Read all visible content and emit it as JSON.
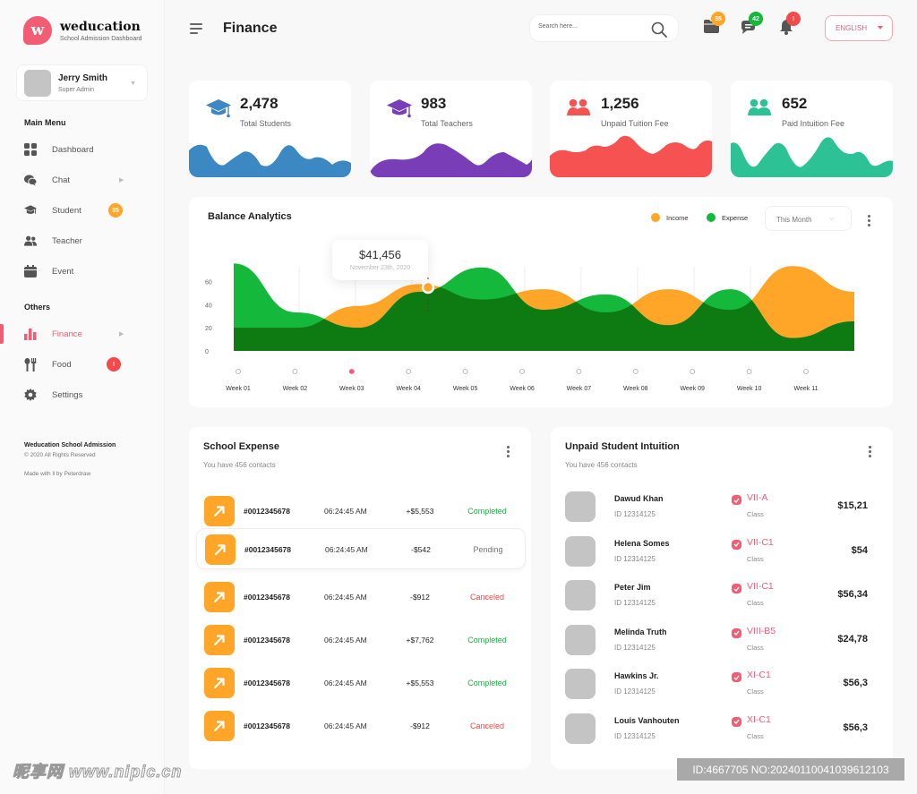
{
  "brand": {
    "logo_letter": "w",
    "name": "weducation",
    "subtitle": "School Admission Dashboard",
    "accent": "#f35d74"
  },
  "user": {
    "name": "Jerry Smith",
    "role": "Super Admin"
  },
  "sidebar": {
    "main_menu_title": "Main Menu",
    "main_items": [
      {
        "label": "Dashboard",
        "icon": "dashboard-grid-icon"
      },
      {
        "label": "Chat",
        "icon": "chat-icon",
        "has_chevron": true
      },
      {
        "label": "Student",
        "icon": "graduation-cap-icon",
        "badge": "35"
      },
      {
        "label": "Teacher",
        "icon": "users-icon"
      },
      {
        "label": "Event",
        "icon": "calendar-icon"
      }
    ],
    "others_title": "Others",
    "other_items": [
      {
        "label": "Finance",
        "icon": "bar-chart-icon",
        "active": true,
        "has_chevron": true
      },
      {
        "label": "Food",
        "icon": "fork-spoon-icon",
        "badge": "!"
      },
      {
        "label": "Settings",
        "icon": "gear-icon"
      }
    ],
    "footer": {
      "title": "Weducation School Admission",
      "copyright": "© 2020 All Rights Reserved",
      "made_with": "Made with ‖ by Peterdraw"
    }
  },
  "header": {
    "title": "Finance",
    "search_placeholder": "Search here...",
    "icons": [
      {
        "name": "folder-icon",
        "badge": "35",
        "color": "#ffa629"
      },
      {
        "name": "messages-icon",
        "badge": "42",
        "color": "#14b83a"
      },
      {
        "name": "bell-icon",
        "badge": "!",
        "color": "#f44a4a"
      }
    ],
    "language": "ENGLISH"
  },
  "stats": [
    {
      "value": "2,478",
      "label": "Total Students",
      "color": "#3b88c3",
      "icon": "graduation-cap-icon"
    },
    {
      "value": "983",
      "label": "Total Teachers",
      "color": "#7a3db8",
      "icon": "graduation-cap-icon"
    },
    {
      "value": "1,256",
      "label": "Unpaid Tuition Fee",
      "color": "#f75252",
      "icon": "users-icon"
    },
    {
      "value": "652",
      "label": "Paid Intuition Fee",
      "color": "#2cc295",
      "icon": "users-icon"
    }
  ],
  "balance": {
    "title": "Balance Analytics",
    "legend": [
      {
        "label": "Income",
        "color": "#ffa629"
      },
      {
        "label": "Expense",
        "color": "#14b83a"
      }
    ],
    "period": "This Month",
    "tooltip": {
      "value": "$41,456",
      "date": "November 23th, 2020"
    },
    "selected_week": "Week 03"
  },
  "chart_data": {
    "type": "area",
    "title": "Balance Analytics",
    "xlabel": "",
    "ylabel": "",
    "categories": [
      "Week 01",
      "Week 02",
      "Week 03",
      "Week 04",
      "Week 05",
      "Week 06",
      "Week 07",
      "Week 08",
      "Week 09",
      "Week 10",
      "Week 11"
    ],
    "y_ticks": [
      0,
      20,
      40,
      60
    ],
    "ylim": [
      0,
      85
    ],
    "legend_position": "top-right",
    "series": [
      {
        "name": "Income",
        "color": "#ffa629",
        "values": [
          18,
          18,
          35,
          52,
          40,
          48,
          30,
          48,
          32,
          66,
          46
        ]
      },
      {
        "name": "Expense",
        "color": "#14b83a",
        "values": [
          68,
          30,
          18,
          46,
          65,
          32,
          44,
          20,
          48,
          10,
          23
        ]
      }
    ],
    "highlight": {
      "series": "Income",
      "value": 41456,
      "label": "$41,456"
    }
  },
  "expense": {
    "title": "School Expense",
    "subtitle": "You have 456 contacts",
    "rows": [
      {
        "id": "#0012345678",
        "time": "06:24:45 AM",
        "amount": "+$5,553",
        "status": "Completed"
      },
      {
        "id": "#0012345678",
        "time": "06:24:45 AM",
        "amount": "-$542",
        "status": "Pending"
      },
      {
        "id": "#0012345678",
        "time": "06:24:45 AM",
        "amount": "-$912",
        "status": "Canceled"
      },
      {
        "id": "#0012345678",
        "time": "06:24:45 AM",
        "amount": "+$7,762",
        "status": "Completed"
      },
      {
        "id": "#0012345678",
        "time": "06:24:45 AM",
        "amount": "+$5,553",
        "status": "Completed"
      },
      {
        "id": "#0012345678",
        "time": "06:24:45 AM",
        "amount": "-$912",
        "status": "Canceled"
      }
    ],
    "status_colors": {
      "Completed": "#14b83a",
      "Pending": "#777777",
      "Canceled": "#f44a4a"
    }
  },
  "unpaid": {
    "title": "Unpaid Student Intuition",
    "subtitle": "You have 456 contacts",
    "class_label": "Class",
    "rows": [
      {
        "name": "Dawud Khan",
        "id": "ID 12314125",
        "class": "VII-A",
        "amount": "$15,21"
      },
      {
        "name": "Helena Somes",
        "id": "ID 12314125",
        "class": "VII-C1",
        "amount": "$54"
      },
      {
        "name": "Peter Jim",
        "id": "ID 12314125",
        "class": "VII-C1",
        "amount": "$56,34"
      },
      {
        "name": "Melinda Truth",
        "id": "ID 12314125",
        "class": "VIII-B5",
        "amount": "$24,78"
      },
      {
        "name": "Hawkins Jr.",
        "id": "ID 12314125",
        "class": "XI-C1",
        "amount": "$56,3"
      },
      {
        "name": "Louis Vanhouten",
        "id": "ID 12314125",
        "class": "XI-C1",
        "amount": "$56,3"
      }
    ]
  },
  "watermark": {
    "left": "昵享网 www.nipic.cn",
    "right": "ID:4667705 NO:20240110041039612103"
  }
}
